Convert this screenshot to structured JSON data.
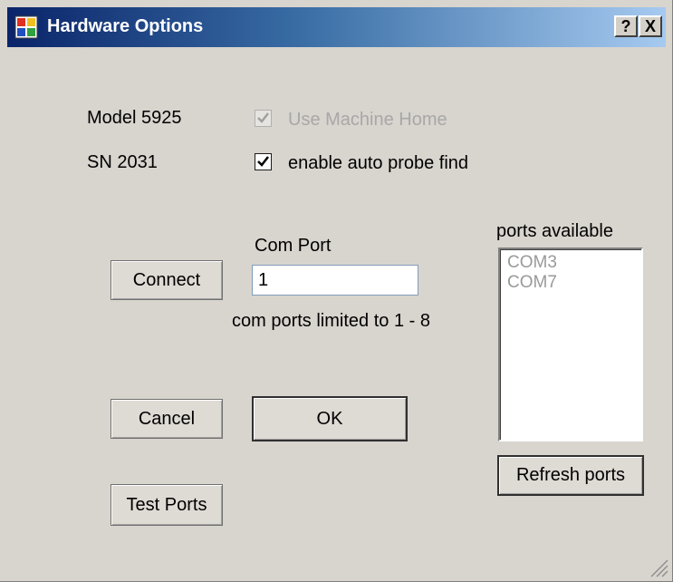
{
  "window": {
    "title": "Hardware Options",
    "help_label": "?",
    "close_label": "X"
  },
  "info": {
    "model": "Model 5925",
    "serial": "SN 2031"
  },
  "options": {
    "use_machine_home": {
      "label": "Use Machine Home",
      "checked": true,
      "enabled": false
    },
    "auto_probe_find": {
      "label": "enable auto probe find",
      "checked": true,
      "enabled": true
    }
  },
  "com_port": {
    "label": "Com Port",
    "value": "1",
    "hint": "com ports limited to 1 - 8"
  },
  "ports": {
    "label": "ports available",
    "items": [
      "COM3",
      "COM7"
    ]
  },
  "buttons": {
    "connect": "Connect",
    "cancel": "Cancel",
    "ok": "OK",
    "test_ports": "Test Ports",
    "refresh_ports": "Refresh ports"
  }
}
